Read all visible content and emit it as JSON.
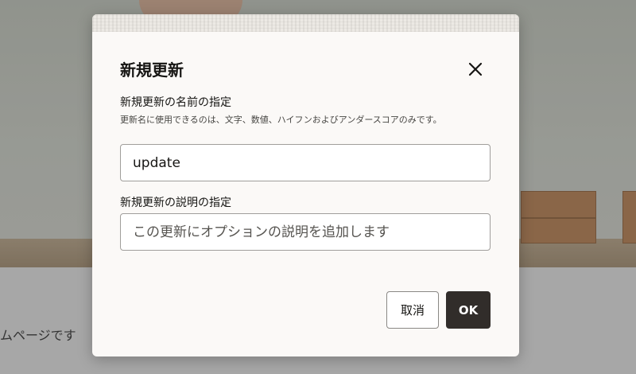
{
  "background_page": {
    "partial_text": "ムページです"
  },
  "dialog": {
    "title": "新規更新",
    "close_icon": "close-icon",
    "name_field": {
      "label": "新規更新の名前の指定",
      "help": "更新名に使用できるのは、文字、数値、ハイフンおよびアンダースコアのみです。",
      "value": "update"
    },
    "description_field": {
      "label": "新規更新の説明の指定",
      "placeholder": "この更新にオプションの説明を追加します",
      "value": ""
    },
    "buttons": {
      "cancel_label": "取消",
      "ok_label": "OK"
    }
  },
  "colors": {
    "primary_button": "#312d2a",
    "dialog_background": "#fbf9f7",
    "overlay": "rgba(40,40,40,0.28)"
  }
}
